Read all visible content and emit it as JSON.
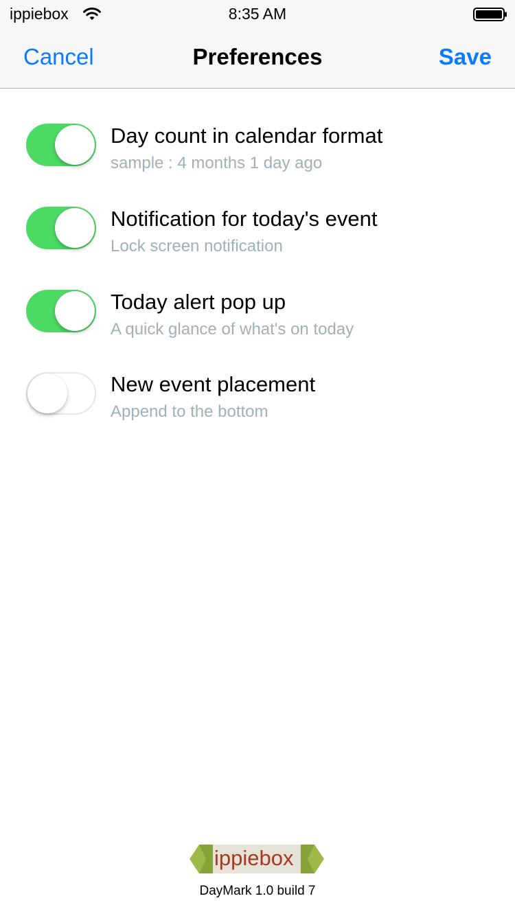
{
  "status_bar": {
    "carrier": "ippiebox",
    "time": "8:35 AM",
    "wifi_icon": "wifi-icon",
    "battery_icon": "battery-full-icon"
  },
  "nav": {
    "cancel_label": "Cancel",
    "title": "Preferences",
    "save_label": "Save",
    "accent_color": "#0a7aff"
  },
  "preferences": [
    {
      "title": "Day count in calendar format",
      "subtitle": "sample : 4 months 1 day ago",
      "enabled": true
    },
    {
      "title": "Notification for today's event",
      "subtitle": "Lock screen notification",
      "enabled": true
    },
    {
      "title": "Today alert pop up",
      "subtitle": "A quick glance of what's on today",
      "enabled": true
    },
    {
      "title": "New event placement",
      "subtitle": "Append to the bottom",
      "enabled": false
    }
  ],
  "toggle_on_color": "#4cd964",
  "footer": {
    "logo_text": "ippiebox",
    "build": "DayMark 1.0 build 7"
  }
}
